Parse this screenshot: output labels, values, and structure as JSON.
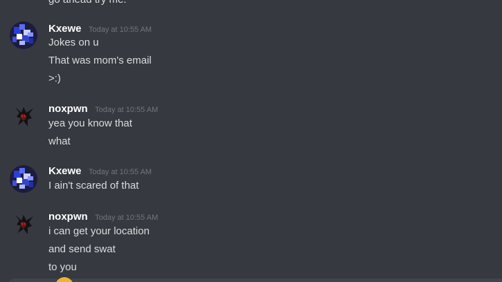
{
  "partial_top": "go ahead try me.",
  "messages": [
    {
      "username": "Kxewe",
      "timestamp": "Today at 10:55 AM",
      "lines": [
        "Jokes on u",
        "That was mom's email",
        ">:)"
      ]
    },
    {
      "username": "noxpwn",
      "timestamp": "Today at 10:55 AM",
      "lines": [
        "yea you know that",
        "what"
      ]
    },
    {
      "username": "Kxewe",
      "timestamp": "Today at 10:55 AM",
      "lines": [
        "I ain't scared of that"
      ]
    },
    {
      "username": "noxpwn",
      "timestamp": "Today at 10:55 AM",
      "lines": [
        "i can get your location",
        "and send swat",
        "to you"
      ]
    }
  ],
  "colors": {
    "background": "#36393f",
    "username": "#ffffff",
    "message_text": "#dcddde",
    "timestamp": "#72767d"
  }
}
